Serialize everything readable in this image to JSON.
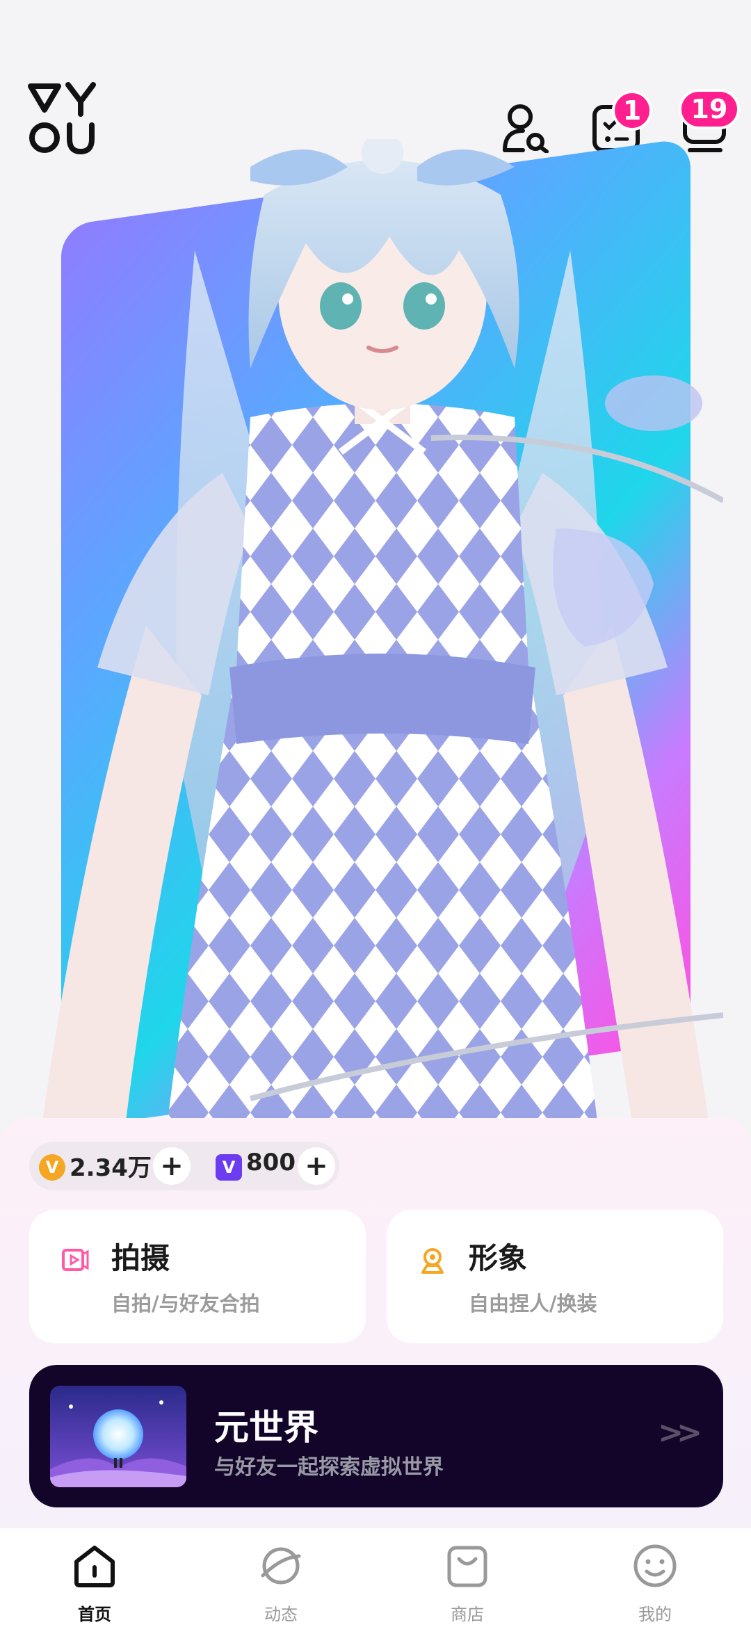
{
  "header": {
    "logo_text": "VYOU",
    "friend_search_icon": "user-search-icon",
    "task_icon": "checklist-icon",
    "task_badge": "1",
    "message_icon": "inbox-icon",
    "message_badge": "19"
  },
  "currency": {
    "coins_value": "2.34万",
    "coin_symbol": "V",
    "coin_color": "#f5a623",
    "gems_value": "800",
    "gem_symbol": "V",
    "gem_color": "#6c3cf0",
    "plus_label": "+"
  },
  "cards": [
    {
      "title": "拍摄",
      "subtitle": "自拍/与好友合拍",
      "icon": "camera-icon",
      "icon_color": "#ff5aa8"
    },
    {
      "title": "形象",
      "subtitle": "自由捏人/换装",
      "icon": "avatar-icon",
      "icon_color": "#f5a623"
    }
  ],
  "meta_world": {
    "title": "元世界",
    "subtitle": "与好友一起探索虚拟世界",
    "arrow": ">>"
  },
  "tabs": [
    {
      "label": "首页",
      "icon": "home-icon",
      "active": true
    },
    {
      "label": "动态",
      "icon": "planet-icon",
      "active": false
    },
    {
      "label": "商店",
      "icon": "bag-icon",
      "active": false
    },
    {
      "label": "我的",
      "icon": "smile-icon",
      "active": false
    }
  ]
}
